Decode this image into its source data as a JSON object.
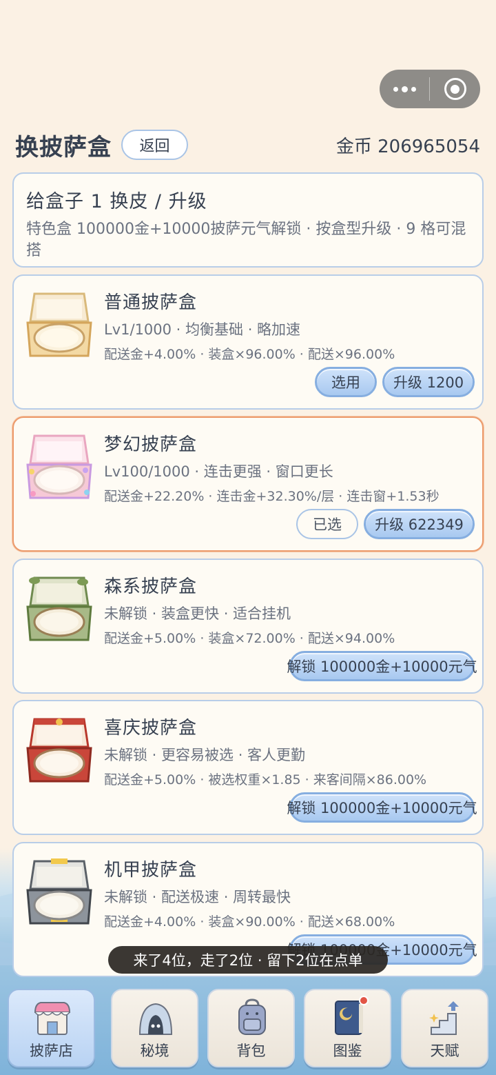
{
  "header": {
    "title": "换披萨盒",
    "back_label": "返回",
    "coins_label": "金币 206965054"
  },
  "info": {
    "title": "给盒子 1 换皮 / 升级",
    "desc": "特色盒 100000金+10000披萨元气解锁 · 按盒型升级 · 9 格可混搭"
  },
  "boxes": [
    {
      "name": "普通披萨盒",
      "tags": "Lv1/1000 · 均衡基础 · 略加速",
      "stats": "配送金+4.00% · 装盒×96.00% · 配送×96.00%",
      "select_label": "选用",
      "action_label": "升级 1200",
      "color": "#f3d9a4"
    },
    {
      "name": "梦幻披萨盒",
      "tags": "Lv100/1000 · 连击更强 · 窗口更长",
      "stats": "配送金+22.20% · 连击金+32.30%/层 · 连击窗+1.53秒",
      "select_label": "已选",
      "action_label": "升级 622349",
      "color": "#f6c9d6"
    },
    {
      "name": "森系披萨盒",
      "tags": "未解锁 · 装盒更快 · 适合挂机",
      "stats": "配送金+5.00% · 装盒×72.00% · 配送×94.00%",
      "action_label": "解锁 100000金+10000元气",
      "color": "#a8b987"
    },
    {
      "name": "喜庆披萨盒",
      "tags": "未解锁 · 更容易被选 · 客人更勤",
      "stats": "配送金+5.00% · 被选权重×1.85 · 来客间隔×86.00%",
      "action_label": "解锁 100000金+10000元气",
      "color": "#c9463a"
    },
    {
      "name": "机甲披萨盒",
      "tags": "未解锁 · 配送极速 · 周转最快",
      "stats": "配送金+4.00% · 装盒×90.00% · 配送×68.00%",
      "action_label": "解锁 100000金+10000元气",
      "color": "#8d949c"
    }
  ],
  "toast": "来了4位，走了2位 · 留下2位在点单",
  "tabs": [
    {
      "label": "披萨店",
      "icon": "pizza-shop-icon"
    },
    {
      "label": "秘境",
      "icon": "cave-icon"
    },
    {
      "label": "背包",
      "icon": "backpack-icon"
    },
    {
      "label": "图鉴",
      "icon": "book-icon"
    },
    {
      "label": "天赋",
      "icon": "stairs-icon"
    }
  ]
}
